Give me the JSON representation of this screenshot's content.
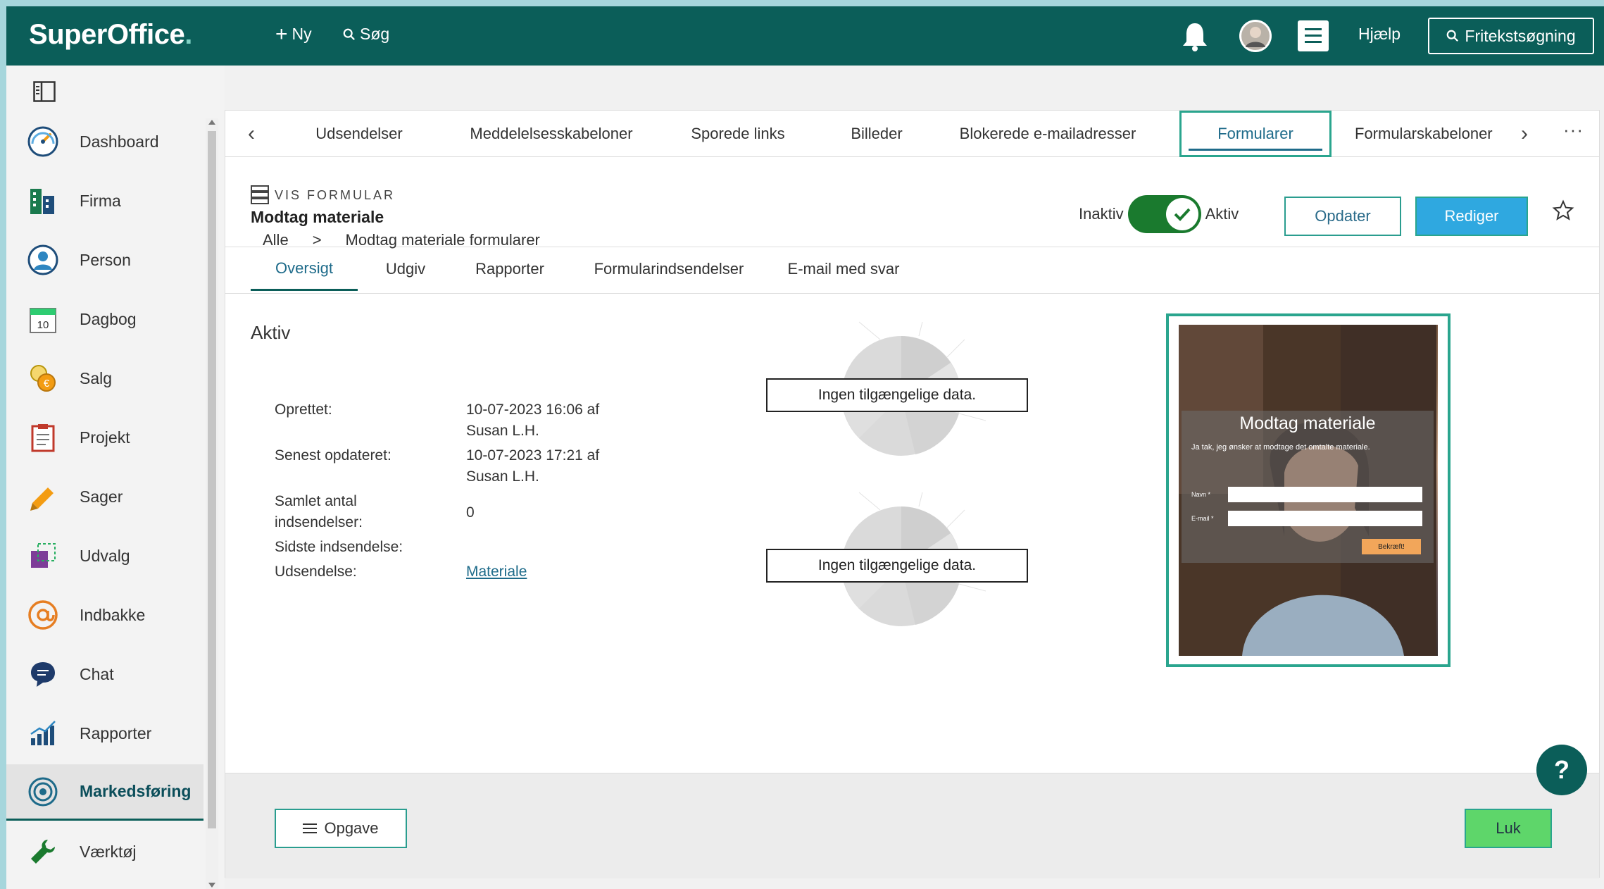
{
  "topbar": {
    "logo": "SuperOffice",
    "logo_dot": ".",
    "new_label": "Ny",
    "search_label": "Søg",
    "help_label": "Hjælp",
    "freetext_label": "Fritekstsøgning"
  },
  "nav": {
    "items": [
      {
        "label": "Dashboard",
        "icon": "gauge-icon"
      },
      {
        "label": "Firma",
        "icon": "building-icon"
      },
      {
        "label": "Person",
        "icon": "person-icon"
      },
      {
        "label": "Dagbog",
        "icon": "calendar-icon",
        "badge": "10"
      },
      {
        "label": "Salg",
        "icon": "coins-icon"
      },
      {
        "label": "Projekt",
        "icon": "clipboard-icon"
      },
      {
        "label": "Sager",
        "icon": "pencil-icon"
      },
      {
        "label": "Udvalg",
        "icon": "selection-icon"
      },
      {
        "label": "Indbakke",
        "icon": "at-icon"
      },
      {
        "label": "Chat",
        "icon": "chat-icon"
      },
      {
        "label": "Rapporter",
        "icon": "bar-chart-icon"
      },
      {
        "label": "Markedsføring",
        "icon": "target-icon",
        "active": true
      },
      {
        "label": "Værktøj",
        "icon": "wrench-icon"
      }
    ]
  },
  "tabs": [
    {
      "label": "Udsendelser"
    },
    {
      "label": "Meddelelsesskabeloner"
    },
    {
      "label": "Sporede links"
    },
    {
      "label": "Billeder"
    },
    {
      "label": "Blokerede e-mailadresser"
    },
    {
      "label": "Formularer",
      "active": true
    },
    {
      "label": "Formularskabeloner"
    }
  ],
  "header": {
    "section_label": "VIS FORMULAR",
    "title": "Modtag materiale",
    "breadcrumb": [
      "Alle",
      ">",
      "Modtag materiale formularer"
    ],
    "toggle_off_label": "Inaktiv",
    "toggle_on_label": "Aktiv",
    "toggle_state": true,
    "update_button": "Opdater",
    "edit_button": "Rediger"
  },
  "subtabs": [
    {
      "label": "Oversigt",
      "active": true
    },
    {
      "label": "Udgiv"
    },
    {
      "label": "Rapporter"
    },
    {
      "label": "Formularindsendelser"
    },
    {
      "label": "E-mail med svar"
    }
  ],
  "overview": {
    "status": "Aktiv",
    "created_label": "Oprettet:",
    "created_value_1": "10-07-2023 16:06 af",
    "created_value_2": "Susan L.H.",
    "updated_label": "Senest opdateret:",
    "updated_value_1": "10-07-2023 17:21 af",
    "updated_value_2": "Susan L.H.",
    "total_label_1": "Samlet antal",
    "total_label_2": "indsendelser:",
    "total_value": "0",
    "last_label": "Sidste indsendelse:",
    "mailing_label": "Udsendelse:",
    "mailing_link": "Materiale",
    "no_data_1": "Ingen tilgængelige data.",
    "no_data_2": "Ingen tilgængelige data."
  },
  "preview": {
    "title": "Modtag materiale",
    "text": "Ja tak, jeg ønsker at modtage det omtalte materiale.",
    "name_label": "Navn *",
    "email_label": "E-mail *",
    "submit": "Bekræft!"
  },
  "footer": {
    "task_button": "Opgave",
    "close_button": "Luk"
  },
  "help_fab": "?",
  "colors": {
    "topbar": "#0b5e59",
    "accent": "#2aa58e",
    "primary_button": "#2fa8e0",
    "toggle_on": "#1a7a2e",
    "close_button": "#5ed66a"
  }
}
